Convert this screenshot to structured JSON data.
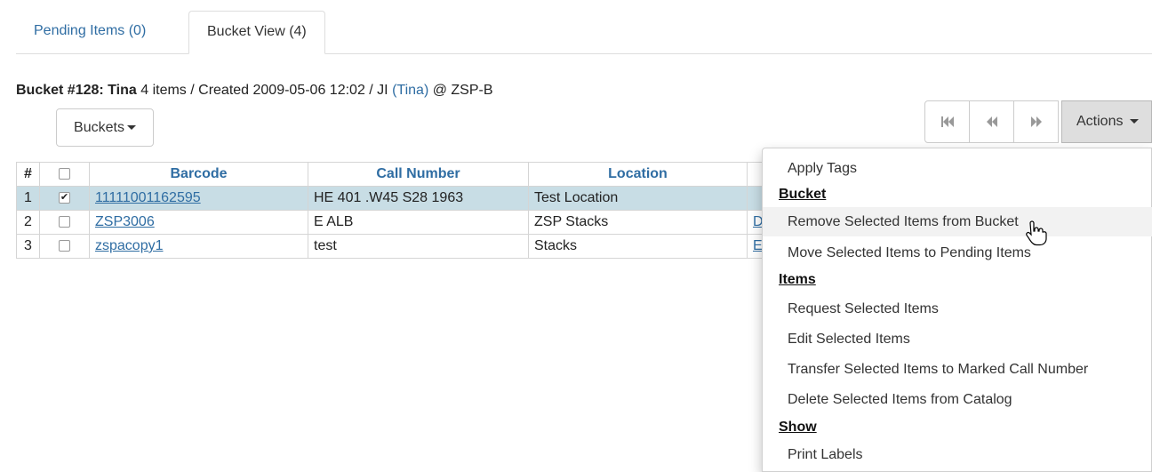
{
  "tabs": [
    {
      "label": "Pending Items (0)"
    },
    {
      "label": "Bucket View (4)"
    }
  ],
  "bucket": {
    "name_prefix": "Bucket #128:",
    "name": "Tina",
    "details": "4 items / Created 2009-05-06 12:02 / JI",
    "owner": "(Tina)",
    "location": "@ ZSP-B"
  },
  "buttons": {
    "buckets": "Buckets",
    "actions": "Actions",
    "first_icon": "first-page-icon",
    "prev_icon": "previous-page-icon",
    "next_icon": "next-page-icon"
  },
  "table": {
    "columns": [
      "#",
      "",
      "Barcode",
      "Call Number",
      "Location"
    ],
    "rows": [
      {
        "num": "1",
        "checked": true,
        "barcode": "11111001162595",
        "call_number": "HE 401 .W45 S28 1963",
        "location": "Test Location",
        "extra": ""
      },
      {
        "num": "2",
        "checked": false,
        "barcode": "ZSP3006",
        "call_number": "E ALB",
        "location": "ZSP Stacks",
        "extra": "D"
      },
      {
        "num": "3",
        "checked": false,
        "barcode": "zspacopy1",
        "call_number": "test",
        "location": "Stacks",
        "extra": "E"
      }
    ]
  },
  "menu": {
    "apply_tags": "Apply Tags",
    "header_bucket": "Bucket",
    "remove": "Remove Selected Items from Bucket",
    "move": "Move Selected Items to Pending Items",
    "header_items": "Items",
    "request": "Request Selected Items",
    "edit": "Edit Selected Items",
    "transfer": "Transfer Selected Items to Marked Call Number",
    "delete": "Delete Selected Items from Catalog",
    "header_show": "Show",
    "print_labels": "Print Labels"
  },
  "colors": {
    "link": "#2f6da3",
    "selected_row": "#c8dde5",
    "actions_bg": "#dedede"
  }
}
